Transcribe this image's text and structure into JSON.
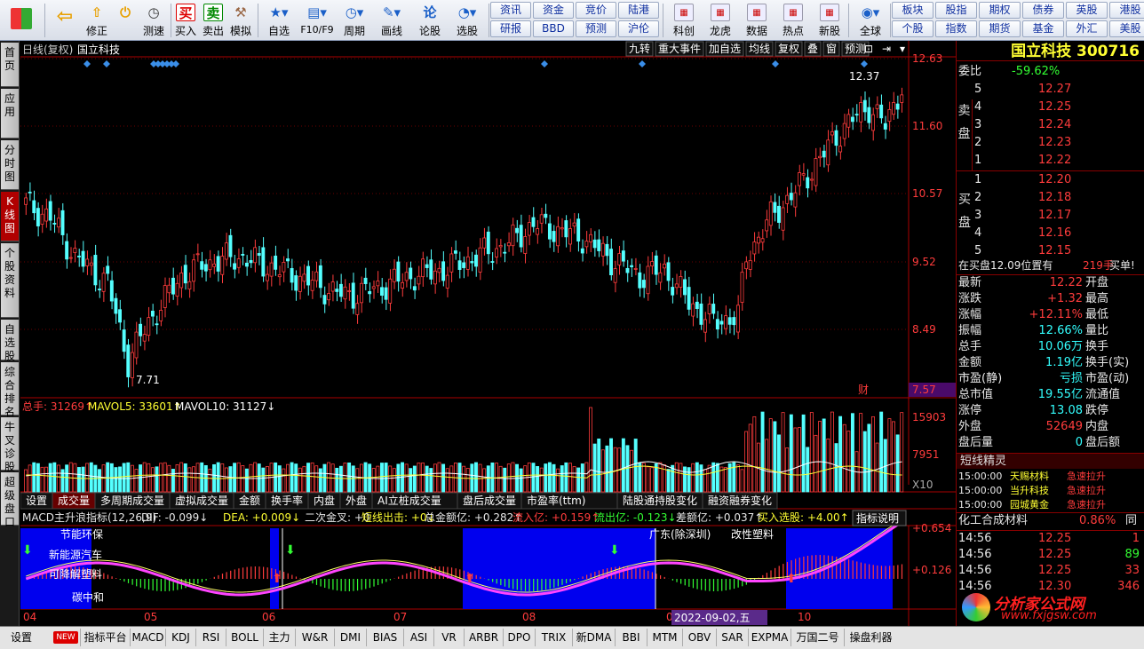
{
  "toolbar": {
    "buttons": [
      {
        "name": "back-button",
        "label": "",
        "icon": "arrow-left-icon"
      },
      {
        "name": "fix-button",
        "label": "修正",
        "icon": "arrow-up-icon"
      },
      {
        "name": "speed-test-button",
        "label": "测速",
        "icon": "clock-icon"
      },
      {
        "name": "buy-button",
        "label": "买入",
        "icon": "买"
      },
      {
        "name": "sell-button",
        "label": "卖出",
        "icon": "卖"
      },
      {
        "name": "simulate-button",
        "label": "模拟",
        "icon": "hammer-icon"
      },
      {
        "name": "watchlist-button",
        "label": "自选",
        "icon": "star-icon"
      },
      {
        "name": "f10-button",
        "label": "F10/F9",
        "icon": "document-icon"
      },
      {
        "name": "period-button",
        "label": "周期",
        "icon": "clock-icon"
      },
      {
        "name": "draw-button",
        "label": "画线",
        "icon": "pencil-icon"
      },
      {
        "name": "stock-discuss-button",
        "label": "论股",
        "icon": "论"
      },
      {
        "name": "stock-pick-button",
        "label": "选股",
        "icon": "chart-icon"
      }
    ],
    "grid1": [
      [
        "资讯",
        "资金",
        "竞价",
        "陆港"
      ],
      [
        "研报",
        "BBD",
        "预测",
        "沪伦"
      ]
    ],
    "feature_buttons": [
      "科创",
      "龙虎",
      "数据",
      "热点",
      "新股"
    ],
    "globe_label": "全球",
    "grid2": [
      [
        "板块",
        "股指",
        "期权",
        "债券",
        "英股",
        "港股"
      ],
      [
        "个股",
        "指数",
        "期货",
        "基金",
        "外汇",
        "美股"
      ]
    ]
  },
  "leftbar": {
    "tabs": [
      "首页",
      "应用",
      "分时图",
      "K线图",
      "个股资料",
      "自选股",
      "综合排名",
      "牛叉诊股",
      "超级盘口"
    ],
    "active": 3
  },
  "main": {
    "period": "日线(复权)",
    "stock_name": "国立科技",
    "top_tools": [
      "九转",
      "重大事件",
      "加自选",
      "均线",
      "复权",
      "叠",
      "窗",
      "预测"
    ],
    "price_axis": [
      "12.63",
      "11.60",
      "10.57",
      "9.52",
      "8.49"
    ],
    "low_marker": "7.57",
    "high_label": "12.37",
    "low_label": "7.71",
    "cai_label": "财",
    "vol_header": {
      "label": "总手:",
      "value": "31269",
      "ma5_label": "MAVOL5:",
      "ma5": "33601",
      "ma10_label": "MAVOL10:",
      "ma10": "31127"
    },
    "vol_axis": [
      "15903",
      "7951",
      "X10"
    ],
    "tabs": [
      "设置",
      "成交量",
      "多周期成交量",
      "虚拟成交量",
      "金额",
      "换手率",
      "内盘",
      "外盘",
      "AI立桩成交量",
      "盘后成交量",
      "市盈率(ttm)",
      "陆股通持股变化",
      "融资融券变化"
    ],
    "active_tab": 1,
    "macd_header": [
      {
        "t": "MACD主升浪指标(12,26,9)",
        "c": "#e8e8e8"
      },
      {
        "t": "DIF: -0.099↓",
        "c": "#e8e8e8"
      },
      {
        "t": "DEA: +0.009↓",
        "c": "#ffff33"
      },
      {
        "t": "二次金叉: +0",
        "c": "#e8e8e8"
      },
      {
        "t": "短线出击: +0↓",
        "c": "#ffff33"
      },
      {
        "t": "总金额亿: +0.282↑",
        "c": "#e8e8e8"
      },
      {
        "t": "流入亿: +0.159↑",
        "c": "#ff3c3c"
      },
      {
        "t": "流出亿: -0.123↓",
        "c": "#33ff33"
      },
      {
        "t": "差额亿: +0.037↑",
        "c": "#e8e8e8"
      },
      {
        "t": "买入选股: +4.00↑",
        "c": "#ffff33"
      }
    ],
    "indicator_help": "指标说明",
    "macd_axis": [
      "+0.654",
      "+0.126"
    ],
    "macd_labels": [
      "节能环保",
      "新能源汽车",
      "可降解塑料",
      "碳中和",
      "广东(除深圳)",
      "改性塑料"
    ],
    "months": [
      "04",
      "05",
      "06",
      "07",
      "08",
      "0",
      "10"
    ],
    "date_label": "2022-09-02,五"
  },
  "right": {
    "title": "国立科技 300716",
    "wb_label": "委比",
    "wb": "-59.62%",
    "sell_label": "卖盘",
    "sells": [
      [
        "5",
        "12.27"
      ],
      [
        "4",
        "12.25"
      ],
      [
        "3",
        "12.24"
      ],
      [
        "2",
        "12.23"
      ],
      [
        "1",
        "12.22"
      ]
    ],
    "buy_label": "买盘",
    "buys": [
      [
        "1",
        "12.20"
      ],
      [
        "2",
        "12.18"
      ],
      [
        "3",
        "12.17"
      ],
      [
        "4",
        "12.16"
      ],
      [
        "5",
        "12.15"
      ]
    ],
    "buy_note": "在买盘12.09位置有",
    "buy_note_vol": "219手",
    "buy_note_tag": "买单!",
    "stats": [
      [
        "最新",
        "12.22",
        "开盘",
        ""
      ],
      [
        "涨跌",
        "+1.32",
        "最高",
        ""
      ],
      [
        "涨幅",
        "+12.11%",
        "最低",
        ""
      ],
      [
        "振幅",
        "12.66%",
        "量比",
        ""
      ],
      [
        "总手",
        "10.06万",
        "换手",
        ""
      ],
      [
        "金额",
        "1.19亿",
        "换手(实)",
        ""
      ],
      [
        "市盈(静)",
        "亏损",
        "市盈(动)",
        ""
      ],
      [
        "总市值",
        "19.55亿",
        "流通值",
        ""
      ],
      [
        "涨停",
        "13.08",
        "跌停",
        ""
      ],
      [
        "外盘",
        "52649",
        "内盘",
        ""
      ],
      [
        "盘后量",
        "0",
        "盘后额",
        ""
      ]
    ],
    "short_title": "短线精灵",
    "short_list": [
      [
        "15:00:00",
        "天赐材料",
        "急速拉升"
      ],
      [
        "15:00:00",
        "当升科技",
        "急速拉升"
      ],
      [
        "15:00:00",
        "园城黄金",
        "急速拉升"
      ]
    ],
    "sector_name": "化工合成材料",
    "sector_pct": "0.86%",
    "sector_extra": "同",
    "ticks": [
      [
        "14:56",
        "12.25",
        "1"
      ],
      [
        "14:56",
        "12.25",
        "89"
      ],
      [
        "14:56",
        "12.25",
        "33"
      ],
      [
        "14:56",
        "12.30",
        "346"
      ]
    ]
  },
  "bottom": {
    "settings": "设置",
    "new_badge": "NEW",
    "items": [
      "指标平台",
      "MACD",
      "KDJ",
      "RSI",
      "BOLL",
      "主力",
      "W&R",
      "DMI",
      "BIAS",
      "ASI",
      "VR",
      "ARBR",
      "DPO",
      "TRIX",
      "新DMA",
      "BBI",
      "MTM",
      "OBV",
      "SAR",
      "EXPMA",
      "万国二号",
      "操盘利器"
    ]
  },
  "watermark": {
    "cn": "分析家公式网",
    "url": "www.fxjgsw.com"
  }
}
